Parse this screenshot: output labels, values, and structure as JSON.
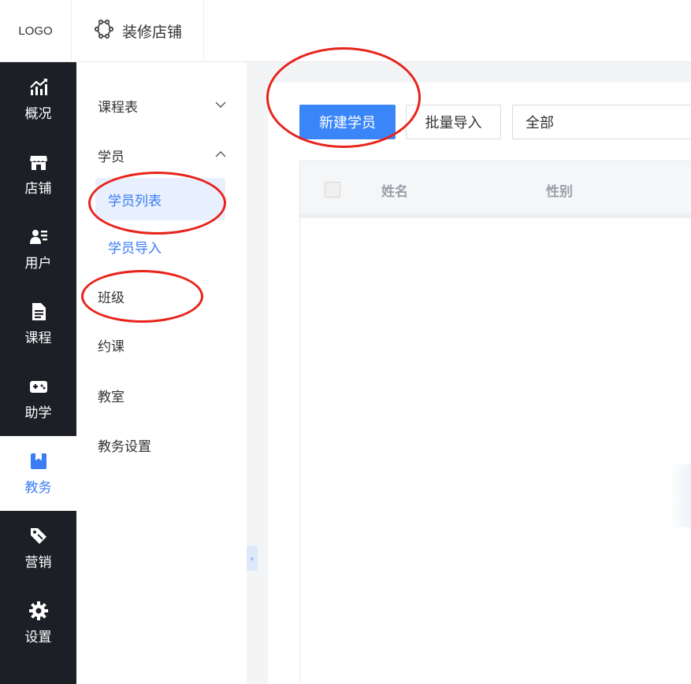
{
  "header": {
    "logo": "LOGO",
    "shop_tab_label": "装修店铺",
    "shop_tab_icon": "settings-gear-icon"
  },
  "rail": {
    "active_color": "#3a7cf5",
    "items": [
      {
        "label": "概况",
        "icon": "chart-trend-icon"
      },
      {
        "label": "店铺",
        "icon": "storefront-icon"
      },
      {
        "label": "用户",
        "icon": "users-icon"
      },
      {
        "label": "课程",
        "icon": "document-icon"
      },
      {
        "label": "助学",
        "icon": "gamepad-icon"
      },
      {
        "label": "教务",
        "icon": "bookmark-book-icon",
        "active": true
      },
      {
        "label": "营销",
        "icon": "tag-icon"
      },
      {
        "label": "设置",
        "icon": "gear-icon"
      }
    ]
  },
  "submenu": {
    "groups": [
      {
        "label": "课程表",
        "expanded": false
      },
      {
        "label": "学员",
        "expanded": true,
        "children": [
          "学员列表",
          "学员导入"
        ],
        "selected": "学员列表"
      },
      {
        "label": "班级"
      },
      {
        "label": "约课"
      },
      {
        "label": "教室"
      },
      {
        "label": "教务设置"
      }
    ],
    "collapse_icon": "‹"
  },
  "toolbar": {
    "new_student": "新建学员",
    "batch_import": "批量导入",
    "filter_value": "全部"
  },
  "table": {
    "columns": [
      "姓名",
      "性别"
    ]
  }
}
